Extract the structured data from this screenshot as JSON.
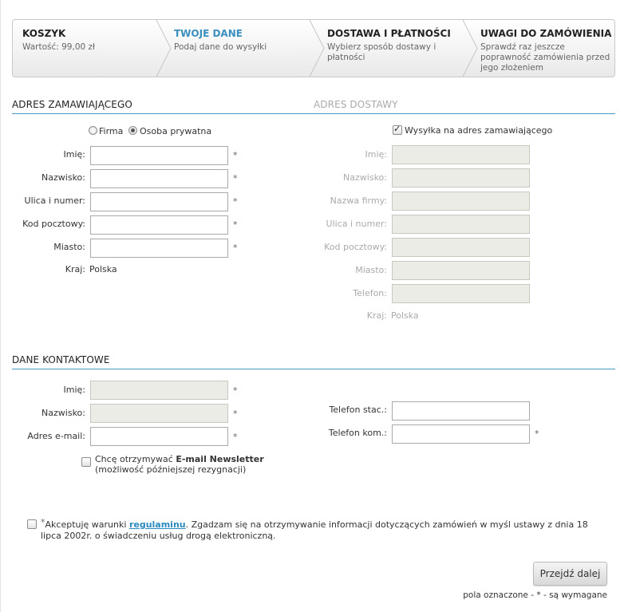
{
  "steps": [
    {
      "title": "KOSZYK",
      "desc": "Wartość: 99,00 zł"
    },
    {
      "title": "TWOJE DANE",
      "desc": "Podaj dane do wysyłki"
    },
    {
      "title": "DOSTAWA I PŁATNOŚCI",
      "desc": "Wybierz sposób dostawy i płatności"
    },
    {
      "title": "UWAGI DO ZAMÓWIENIA",
      "desc": "Sprawdź raz jeszcze poprawność zamówienia przed jego złożeniem"
    }
  ],
  "billing": {
    "title": "ADRES ZAMAWIAJĄCEGO",
    "radio_company": "Firma",
    "radio_private": "Osoba prywatna",
    "labels": {
      "first_name": "Imię:",
      "last_name": "Nazwisko:",
      "street": "Ulica i numer:",
      "postal": "Kod pocztowy:",
      "city": "Miasto:",
      "country": "Kraj:"
    },
    "country_value": "Polska",
    "required_mark": "*"
  },
  "shipping": {
    "title": "ADRES DOSTAWY",
    "same_address_label": "Wysyłka na adres zamawiającego",
    "labels": {
      "first_name": "Imię:",
      "last_name": "Nazwisko:",
      "company": "Nazwa firmy:",
      "street": "Ulica i numer:",
      "postal": "Kod pocztowy:",
      "city": "Miasto:",
      "phone": "Telefon:",
      "country": "Kraj:"
    },
    "country_value": "Polska"
  },
  "contact": {
    "title": "DANE KONTAKTOWE",
    "labels": {
      "first_name": "Imię:",
      "last_name": "Nazwisko:",
      "email": "Adres e-mail:",
      "phone_landline": "Telefon stac.:",
      "phone_mobile": "Telefon kom.:"
    },
    "newsletter_prefix": "Chcę otrzymywać ",
    "newsletter_bold": "E-mail Newsletter",
    "newsletter_note": "(możliwość późniejszej rezygnacji)"
  },
  "terms": {
    "star": "*",
    "prefix": "Akceptuję warunki ",
    "link": "regulaminu",
    "suffix": ". Zgadzam się na otrzymywanie informacji dotyczących zamówień w myśl ustawy z dnia 18 lipca 2002r. o świadczeniu usług drogą elektroniczną."
  },
  "next_button": "Przejdź dalej",
  "required_note": "pola oznaczone - * - są wymagane",
  "colors": {
    "accent": "#3a8fbf",
    "section_line": "#4a98c4",
    "disabled_field": "#ecece7"
  }
}
